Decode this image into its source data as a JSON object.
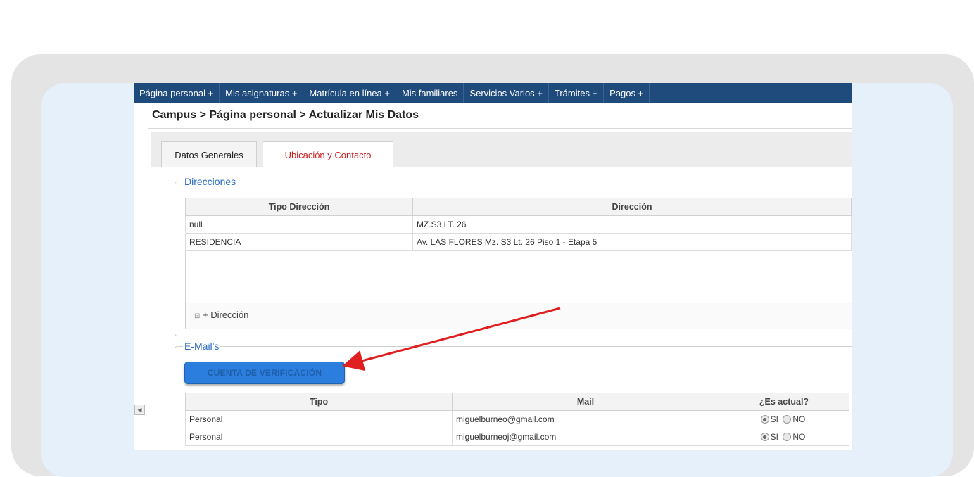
{
  "nav": {
    "items": [
      "Página personal +",
      "Mis asignaturas +",
      "Matrícula en línea +",
      "Mis familiares",
      "Servicios Varios +",
      "Trámites +",
      "Pagos +"
    ]
  },
  "breadcrumb": "Campus > Página personal > Actualizar Mis Datos",
  "tabs": {
    "general": "Datos Generales",
    "contact": "Ubicación y Contacto"
  },
  "direcciones": {
    "title": "Direcciones",
    "columns": [
      "Tipo Dirección",
      "Dirección"
    ],
    "rows": [
      {
        "tipo": "null",
        "direccion": "MZ.S3 LT. 26"
      },
      {
        "tipo": "RESIDENCIA",
        "direccion": "Av. LAS FLORES Mz. S3 Lt. 26 Piso 1 - Etapa 5"
      }
    ],
    "add_label": "+ Dirección"
  },
  "emails": {
    "title": "E-Mail's",
    "verify_button": "CUENTA DE VERIFICACIÓN",
    "columns": [
      "Tipo",
      "Mail",
      "¿Es actual?"
    ],
    "rows": [
      {
        "tipo": "Personal",
        "mail": "miguelburneo@gmail.com",
        "si": "SI",
        "no": "NO"
      },
      {
        "tipo": "Personal",
        "mail": "miguelburneoj@gmail.com",
        "si": "SI",
        "no": "NO"
      }
    ]
  },
  "colors": {
    "nav_bg": "#1f4a7c",
    "accent_tab": "#cc2222",
    "group_title": "#2a6cc0",
    "verify_button": "#2b7ede",
    "annotation_arrow": "#e02020"
  }
}
